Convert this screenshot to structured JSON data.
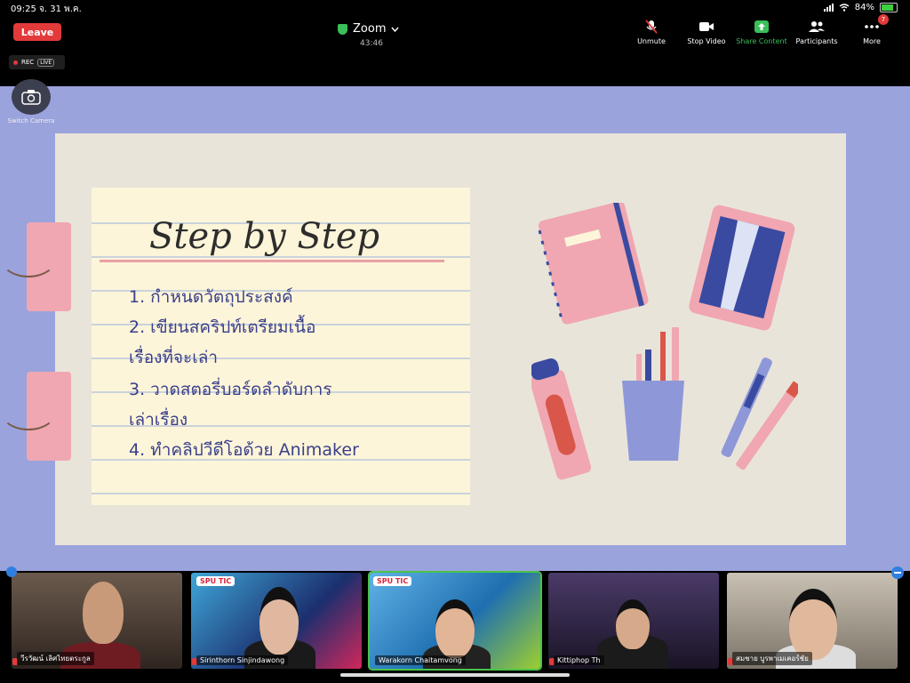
{
  "status_bar": {
    "time": "09:25",
    "date": "จ. 31 พ.ค.",
    "battery": "84%",
    "battery_level": 0.84
  },
  "top_bar": {
    "leave_label": "Leave",
    "title": "Zoom",
    "timer": "43:46",
    "controls": [
      {
        "label": "Unmute",
        "icon": "mic-muted-icon"
      },
      {
        "label": "Stop Video",
        "icon": "video-camera-icon"
      },
      {
        "label": "Share Content",
        "icon": "share-up-arrow-icon"
      },
      {
        "label": "Participants",
        "icon": "participants-icon"
      },
      {
        "label": "More",
        "icon": "more-dots-icon",
        "badge": "7"
      }
    ],
    "rec_label": "REC",
    "live_label": "LIVE"
  },
  "switch_camera_label": "Switch Camera",
  "slide": {
    "title": "Step by Step",
    "items": [
      "1. กำหนดวัตถุประสงค์",
      "2. เขียนสคริปท์เตรียมเนื้อ",
      "เรื่องที่จะเล่า",
      "3. วาดสตอรี่บอร์ดลำดับการ",
      "เล่าเรื่อง",
      "4. ทำคลิปวีดีโอด้วย Animaker"
    ]
  },
  "participants": [
    {
      "name": "วีรวัฒน์ เลิศไทยตระกูล",
      "muted": true
    },
    {
      "name": "Sirinthorn Sinjindawong",
      "muted": true,
      "logo": "SPU TIC"
    },
    {
      "name": "Warakorn Chaitamvong",
      "muted": false,
      "logo": "SPU TIC",
      "active": true
    },
    {
      "name": "Kittiphop Th",
      "muted": true
    },
    {
      "name": "สมชาย บูรพาเมเคอร์ชัย",
      "muted": true
    }
  ],
  "colors": {
    "leave": "#e23a3a",
    "share_background": "#9aa3dc",
    "accent_green": "#49c34a",
    "slide_text": "#3a3f8a"
  }
}
